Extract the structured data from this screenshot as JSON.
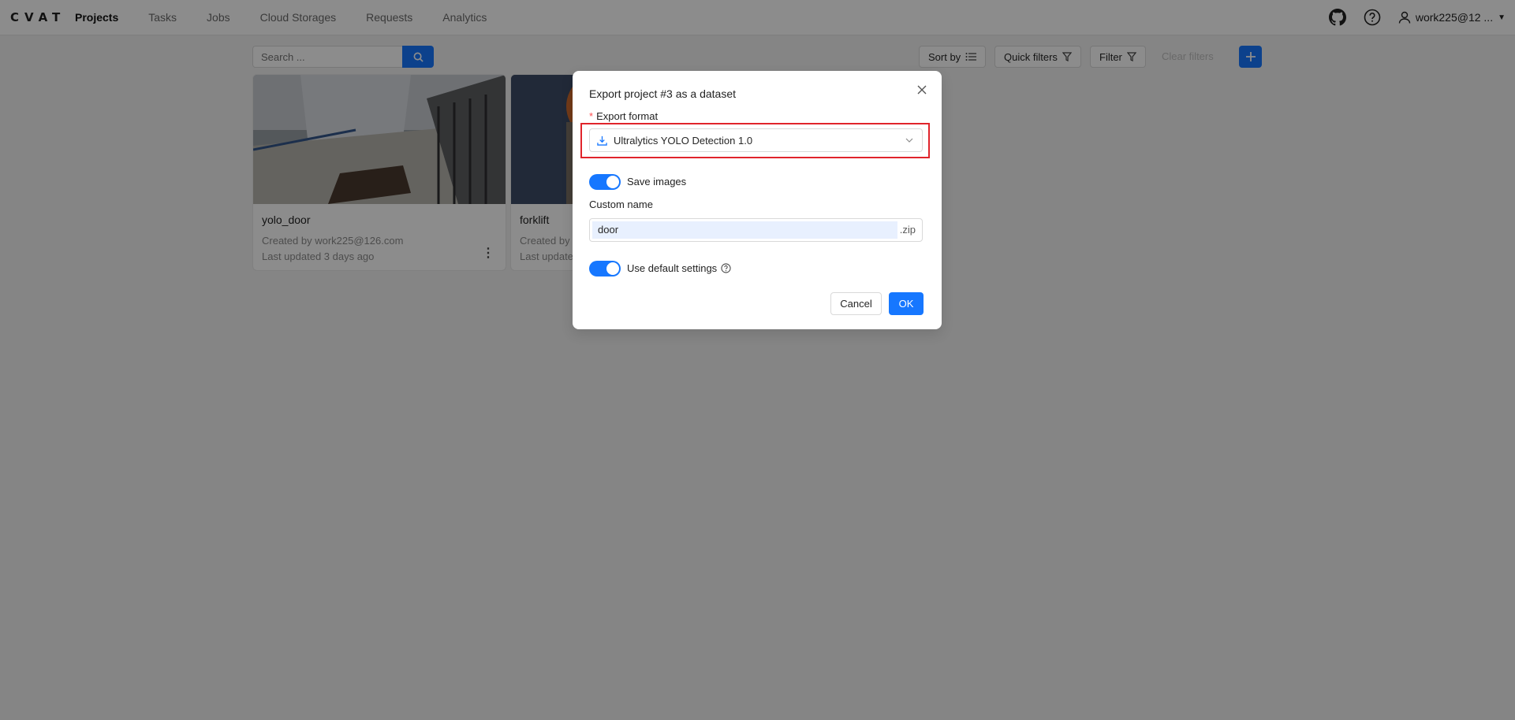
{
  "header": {
    "logo": "CVAT",
    "nav": [
      {
        "label": "Projects",
        "active": true
      },
      {
        "label": "Tasks"
      },
      {
        "label": "Jobs"
      },
      {
        "label": "Cloud Storages"
      },
      {
        "label": "Requests"
      },
      {
        "label": "Analytics"
      }
    ],
    "user": "work225@12 ..."
  },
  "toolbar": {
    "search_placeholder": "Search ...",
    "sort_by": "Sort by",
    "quick_filters": "Quick filters",
    "filter": "Filter",
    "clear_filters": "Clear filters"
  },
  "cards": [
    {
      "title": "yolo_door",
      "created_by": "Created by work225@126.com",
      "updated": "Last updated 3 days ago"
    },
    {
      "title": "forklift",
      "created_by": "Created by w",
      "updated": "Last update"
    }
  ],
  "modal": {
    "title": "Export project #3 as a dataset",
    "required_mark": "*",
    "export_format_label": "Export format",
    "export_format_value": "Ultralytics YOLO Detection 1.0",
    "save_images_label": "Save images",
    "save_images_on": true,
    "custom_name_label": "Custom name",
    "custom_name_value": "door",
    "custom_name_suffix": ".zip",
    "use_default_label": "Use default settings",
    "use_default_on": true,
    "cancel": "Cancel",
    "ok": "OK"
  },
  "colors": {
    "primary": "#1677ff",
    "highlight": "#e0242b"
  }
}
